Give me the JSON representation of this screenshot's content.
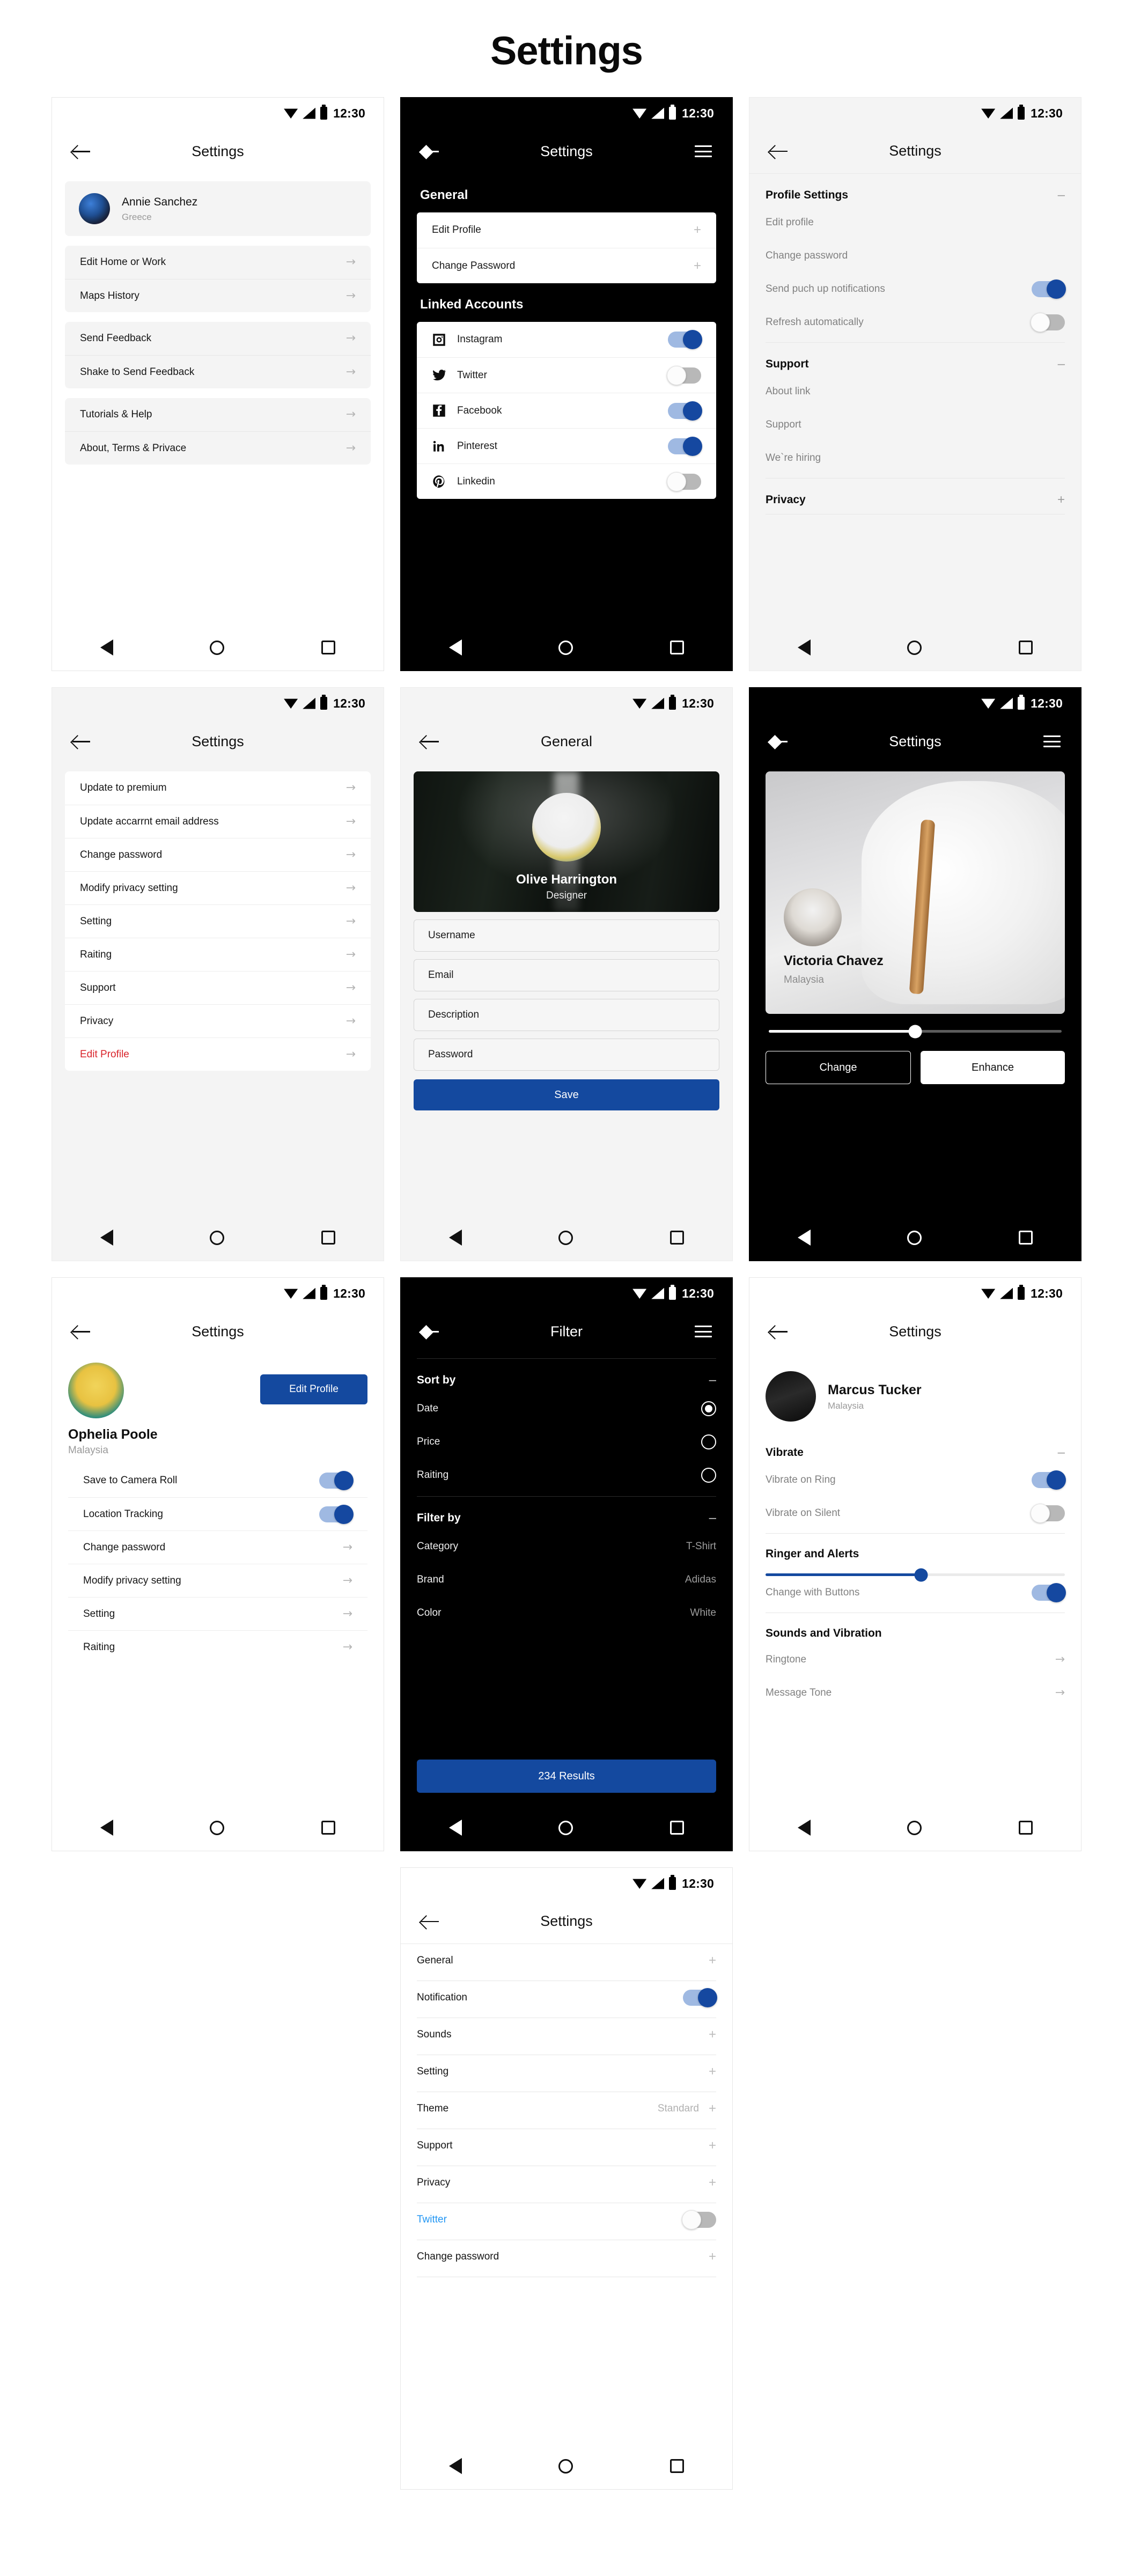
{
  "page": {
    "title": "Settings"
  },
  "common": {
    "status_time": "12:30",
    "chevron": "→",
    "plus": "+",
    "minus": "–"
  },
  "screens": {
    "s1": {
      "appbar_title": "Settings",
      "profile": {
        "name": "Annie Sanchez",
        "location": "Greece"
      },
      "groups": [
        {
          "items": [
            "Edit Home or Work",
            "Maps History"
          ]
        },
        {
          "items": [
            "Send Feedback",
            "Shake to Send Feedback"
          ]
        },
        {
          "items": [
            "Tutorials & Help",
            "About, Terms & Privace"
          ]
        }
      ]
    },
    "s2": {
      "appbar_title": "Settings",
      "section_general": "General",
      "general_items": [
        {
          "label": "Edit Profile",
          "sign": "+"
        },
        {
          "label": "Change Password",
          "sign": "+"
        }
      ],
      "section_linked": "Linked Accounts",
      "linked_items": [
        {
          "label": "Instagram",
          "icon": "instagram-icon",
          "on": true
        },
        {
          "label": "Twitter",
          "icon": "twitter-icon",
          "on": false
        },
        {
          "label": "Facebook",
          "icon": "facebook-icon",
          "on": true
        },
        {
          "label": "Pinterest",
          "icon": "linkedin-icon",
          "on": true
        },
        {
          "label": "Linkedin",
          "icon": "pinterest-icon",
          "on": false
        }
      ]
    },
    "s3": {
      "appbar_title": "Settings",
      "sections": [
        {
          "title": "Profile Settings",
          "sign": "–",
          "rows": [
            {
              "label": "Edit profile",
              "type": "plain"
            },
            {
              "label": "Change password",
              "type": "plain"
            },
            {
              "label": "Send puch up notifications",
              "type": "toggle",
              "on": true
            },
            {
              "label": "Refresh automatically",
              "type": "toggle",
              "on": false
            }
          ]
        },
        {
          "title": "Support",
          "sign": "–",
          "rows": [
            {
              "label": "About link",
              "type": "plain"
            },
            {
              "label": "Support",
              "type": "plain"
            },
            {
              "label": "We`re hiring",
              "type": "plain"
            }
          ]
        },
        {
          "title": "Privacy",
          "sign": "+",
          "rows": []
        }
      ]
    },
    "s4": {
      "appbar_title": "Settings",
      "items": [
        {
          "label": "Update to premium",
          "danger": false
        },
        {
          "label": "Update accarrnt email address",
          "danger": false
        },
        {
          "label": "Change password",
          "danger": false
        },
        {
          "label": "Modify privacy setting",
          "danger": false
        },
        {
          "label": "Setting",
          "danger": false
        },
        {
          "label": "Raiting",
          "danger": false
        },
        {
          "label": "Support",
          "danger": false
        },
        {
          "label": "Privacy",
          "danger": false
        },
        {
          "label": "Edit Profile",
          "danger": true
        }
      ]
    },
    "s5": {
      "appbar_title": "General",
      "hero": {
        "name": "Olive Harrington",
        "role": "Designer"
      },
      "fields": [
        {
          "placeholder": "Username",
          "value": "Username"
        },
        {
          "placeholder": "Email",
          "value": "Email"
        },
        {
          "placeholder": "Description",
          "value": "Description"
        },
        {
          "placeholder": "Password",
          "value": "Password"
        }
      ],
      "save_label": "Save"
    },
    "s6": {
      "appbar_title": "Settings",
      "photo": {
        "name": "Victoria Chavez",
        "location": "Malaysia"
      },
      "slider_percent": 50,
      "btn_change": "Change",
      "btn_enhance": "Enhance"
    },
    "s7": {
      "appbar_title": "Settings",
      "edit_profile_label": "Edit Profile",
      "profile": {
        "name": "Ophelia Poole",
        "location": "Malaysia"
      },
      "rows": [
        {
          "label": "Save to Camera Roll",
          "type": "toggle",
          "on": true
        },
        {
          "label": "Location Tracking",
          "type": "toggle",
          "on": true
        },
        {
          "label": "Change password",
          "type": "chev"
        },
        {
          "label": "Modify privacy setting",
          "type": "chev"
        },
        {
          "label": "Setting",
          "type": "chev"
        },
        {
          "label": "Raiting",
          "type": "chev"
        }
      ]
    },
    "s8": {
      "appbar_title": "Filter",
      "sort_by": {
        "title": "Sort by",
        "sign": "–"
      },
      "sort_options": [
        {
          "label": "Date",
          "selected": true
        },
        {
          "label": "Price",
          "selected": false
        },
        {
          "label": "Raiting",
          "selected": false
        }
      ],
      "filter_by": {
        "title": "Filter by",
        "sign": "–"
      },
      "filter_rows": [
        {
          "label": "Category",
          "value": "T-Shirt"
        },
        {
          "label": "Brand",
          "value": "Adidas"
        },
        {
          "label": "Color",
          "value": "White"
        }
      ],
      "results_label": "234 Results"
    },
    "s9": {
      "appbar_title": "Settings",
      "profile": {
        "name": "Marcus Tucker",
        "location": "Malaysia"
      },
      "vibrate": {
        "title": "Vibrate",
        "sign": "–"
      },
      "vibrate_rows": [
        {
          "label": "Vibrate on Ring",
          "on": true
        },
        {
          "label": "Vibrate on Silent",
          "on": false
        }
      ],
      "ringer": {
        "title": "Ringer and Alerts",
        "slider_percent": 52
      },
      "ringer_row": {
        "label": "Change with Buttons",
        "on": true
      },
      "sounds": {
        "title": "Sounds and Vibration"
      },
      "sounds_rows": [
        {
          "label": "Ringtone"
        },
        {
          "label": "Message Tone"
        }
      ]
    },
    "s10": {
      "appbar_title": "Settings",
      "rows": [
        {
          "label": "General",
          "type": "plus"
        },
        {
          "label": "Notification",
          "type": "toggle",
          "on": true
        },
        {
          "label": "Sounds",
          "type": "plus"
        },
        {
          "label": "Setting",
          "type": "plus"
        },
        {
          "label": "Theme",
          "type": "plus",
          "value": "Standard"
        },
        {
          "label": "Support",
          "type": "plus"
        },
        {
          "label": "Privacy",
          "type": "plus"
        },
        {
          "label": "Twitter",
          "type": "toggle",
          "on": false,
          "link": true
        },
        {
          "label": "Change password",
          "type": "plus"
        }
      ]
    }
  },
  "colors": {
    "accent": "#14499f",
    "toggle_on_track": "#9fb9e2",
    "toggle_on_knob": "#1548a0",
    "toggle_off": "#b8b8b8",
    "danger": "#d9242b",
    "link": "#2196f3"
  }
}
